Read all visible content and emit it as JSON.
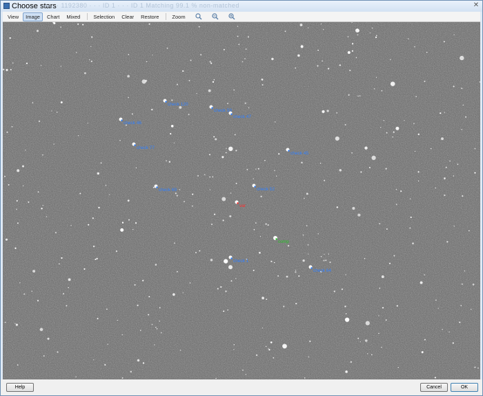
{
  "window": {
    "title": "Choose stars",
    "title_extra": "— · · 1192380 · · · ID 1 · · · ID 1 Matching 99.1 % non-matched"
  },
  "toolbar": {
    "items": [
      "View",
      "Image",
      "Chart",
      "Mixed",
      "Selection",
      "Clear",
      "Restore",
      "Zoom"
    ],
    "active": "Image",
    "zoom_icons": [
      "zoom-fit-icon",
      "zoom-out-icon",
      "zoom-in-icon"
    ]
  },
  "image": {
    "background_color": "#6a6a6a",
    "labels": [
      {
        "text": "check 120",
        "kind": "check"
      },
      {
        "text": "check 59",
        "kind": "check"
      },
      {
        "text": "check 47",
        "kind": "check"
      },
      {
        "text": "check 46",
        "kind": "check"
      },
      {
        "text": "check 77",
        "kind": "check"
      },
      {
        "text": "check 45",
        "kind": "check"
      },
      {
        "text": "check 69",
        "kind": "check"
      },
      {
        "text": "check 52",
        "kind": "check"
      },
      {
        "text": "var",
        "kind": "var"
      },
      {
        "text": "comp",
        "kind": "comp"
      },
      {
        "text": "check 1",
        "kind": "check"
      },
      {
        "text": "check 64",
        "kind": "check"
      }
    ],
    "colors": {
      "check": "#2f7fff",
      "var": "#ff2a2a",
      "comp": "#25c225"
    }
  },
  "buttons": {
    "help": "Help",
    "cancel": "Cancel",
    "ok": "OK"
  }
}
